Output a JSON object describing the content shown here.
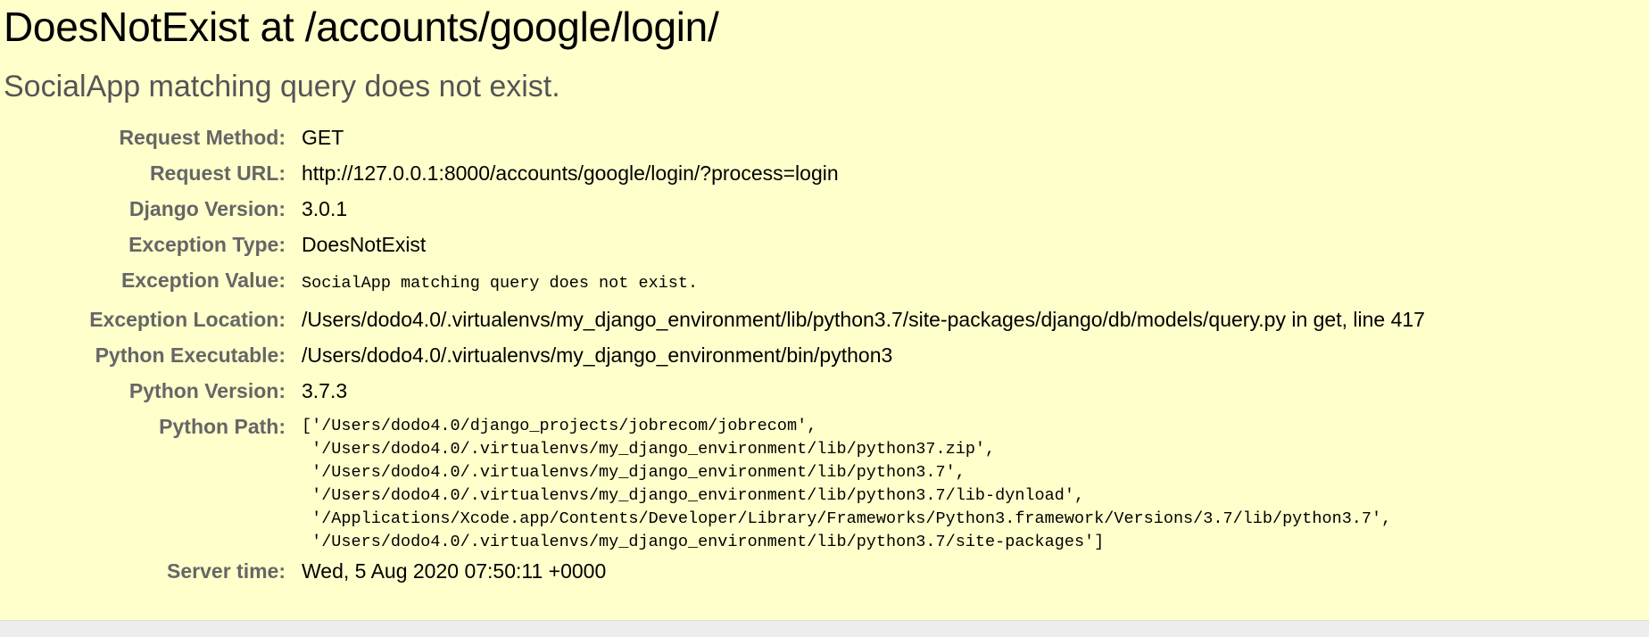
{
  "summary": {
    "title": "DoesNotExist at /accounts/google/login/",
    "subtitle": "SocialApp matching query does not exist."
  },
  "meta": {
    "request_method_label": "Request Method:",
    "request_method": "GET",
    "request_url_label": "Request URL:",
    "request_url": "http://127.0.0.1:8000/accounts/google/login/?process=login",
    "django_version_label": "Django Version:",
    "django_version": "3.0.1",
    "exception_type_label": "Exception Type:",
    "exception_type": "DoesNotExist",
    "exception_value_label": "Exception Value:",
    "exception_value": "SocialApp matching query does not exist.",
    "exception_location_label": "Exception Location:",
    "exception_location": "/Users/dodo4.0/.virtualenvs/my_django_environment/lib/python3.7/site-packages/django/db/models/query.py in get, line 417",
    "python_executable_label": "Python Executable:",
    "python_executable": "/Users/dodo4.0/.virtualenvs/my_django_environment/bin/python3",
    "python_version_label": "Python Version:",
    "python_version": "3.7.3",
    "python_path_label": "Python Path:",
    "python_path": [
      "['/Users/dodo4.0/django_projects/jobrecom/jobrecom',",
      " '/Users/dodo4.0/.virtualenvs/my_django_environment/lib/python37.zip',",
      " '/Users/dodo4.0/.virtualenvs/my_django_environment/lib/python3.7',",
      " '/Users/dodo4.0/.virtualenvs/my_django_environment/lib/python3.7/lib-dynload',",
      " '/Applications/Xcode.app/Contents/Developer/Library/Frameworks/Python3.framework/Versions/3.7/lib/python3.7',",
      " '/Users/dodo4.0/.virtualenvs/my_django_environment/lib/python3.7/site-packages']"
    ],
    "server_time_label": "Server time:",
    "server_time": "Wed, 5 Aug 2020 07:50:11 +0000"
  }
}
